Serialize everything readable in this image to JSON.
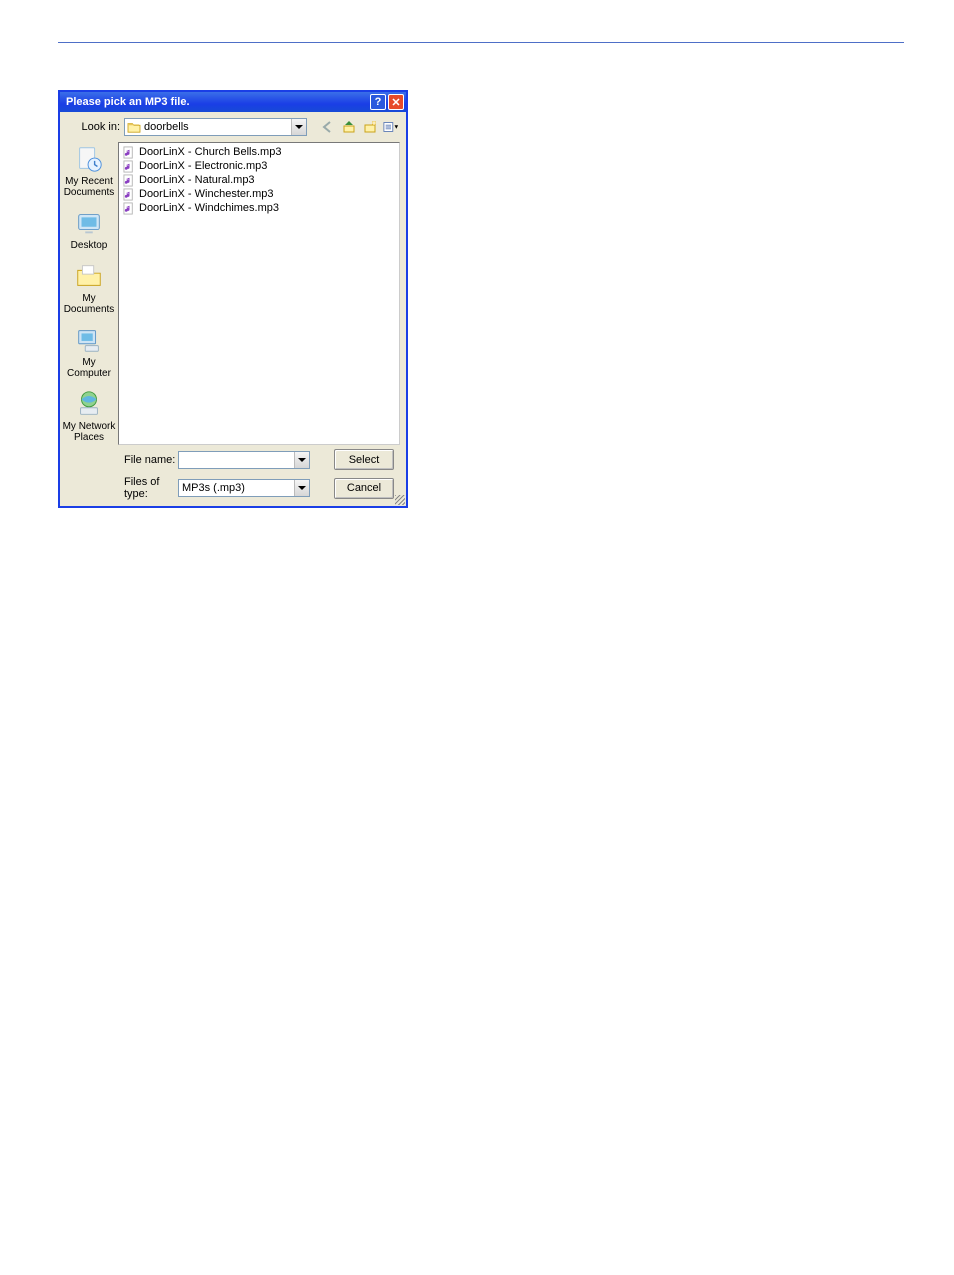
{
  "dialog": {
    "title": "Please pick an MP3 file.",
    "look_in_label": "Look in:",
    "look_in_value": "doorbells",
    "file_name_label": "File name:",
    "file_name_value": "",
    "files_of_type_label": "Files of type:",
    "files_of_type_value": "MP3s (.mp3)",
    "select_button": "Select",
    "cancel_button": "Cancel",
    "places": {
      "recent": "My Recent Documents",
      "desktop": "Desktop",
      "mydocs": "My Documents",
      "mycomp": "My Computer",
      "network": "My Network Places"
    },
    "files": [
      "DoorLinX - Church Bells.mp3",
      "DoorLinX - Electronic.mp3",
      "DoorLinX - Natural.mp3",
      "DoorLinX - Winchester.mp3",
      "DoorLinX - Windchimes.mp3"
    ]
  },
  "page_number_hint": " "
}
